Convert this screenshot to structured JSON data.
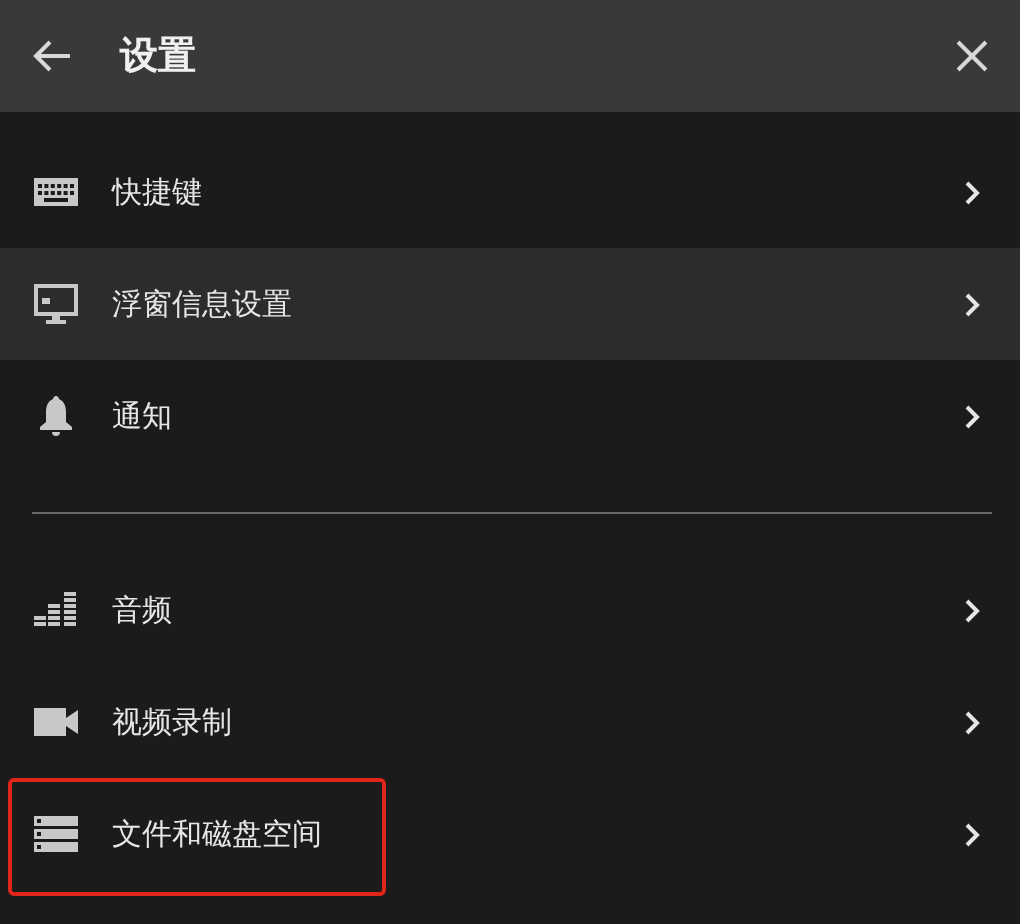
{
  "header": {
    "title": "设置"
  },
  "groups": [
    {
      "items": [
        {
          "kind": "keyboard",
          "label": "快捷键",
          "hovered": false,
          "outlined": false
        },
        {
          "kind": "monitor",
          "label": "浮窗信息设置",
          "hovered": true,
          "outlined": false
        },
        {
          "kind": "bell",
          "label": "通知",
          "hovered": false,
          "outlined": false
        }
      ]
    },
    {
      "items": [
        {
          "kind": "equalizer",
          "label": "音频",
          "hovered": false,
          "outlined": false
        },
        {
          "kind": "camera",
          "label": "视频录制",
          "hovered": false,
          "outlined": false
        },
        {
          "kind": "storage",
          "label": "文件和磁盘空间",
          "hovered": false,
          "outlined": true
        }
      ]
    }
  ]
}
